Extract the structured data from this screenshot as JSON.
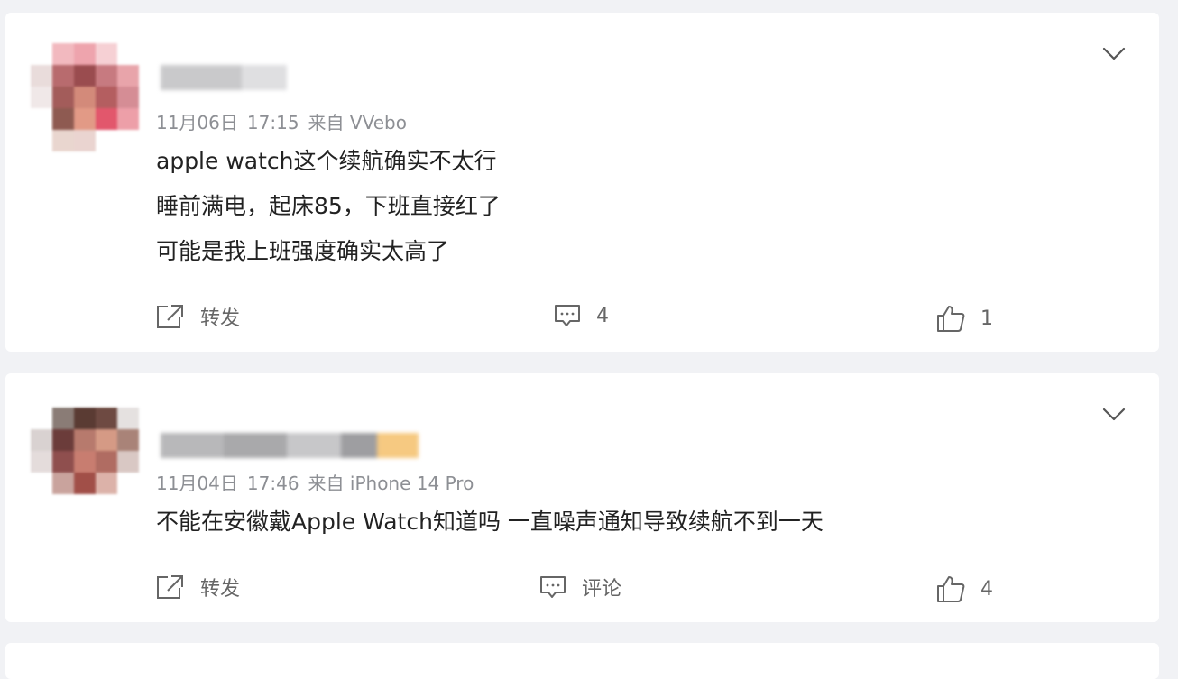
{
  "posts": [
    {
      "date": "11月06日",
      "time": "17:15",
      "source": "来自 VVebo",
      "lines": [
        "apple watch这个续航确实不太行",
        "睡前满电，起床85，下班直接红了",
        "可能是我上班强度确实太高了"
      ],
      "actions": {
        "repost_label": "转发",
        "comment_label": "4",
        "like_count": "1"
      }
    },
    {
      "date": "11月04日",
      "time": "17:46",
      "source": "来自 iPhone 14 Pro",
      "lines": [
        "不能在安徽戴Apple Watch知道吗 一直噪声通知导致续航不到一天"
      ],
      "actions": {
        "repost_label": "转发",
        "comment_label": "评论",
        "like_count": "4"
      }
    }
  ],
  "icons": {
    "expand": "chevron-down-icon",
    "repost": "repost-icon",
    "comment": "comment-icon",
    "like": "thumbs-up-icon"
  },
  "colors": {
    "page_bg": "#f1f2f5",
    "card_bg": "#ffffff",
    "meta_text": "#8d8f94",
    "body_text": "#222222"
  }
}
